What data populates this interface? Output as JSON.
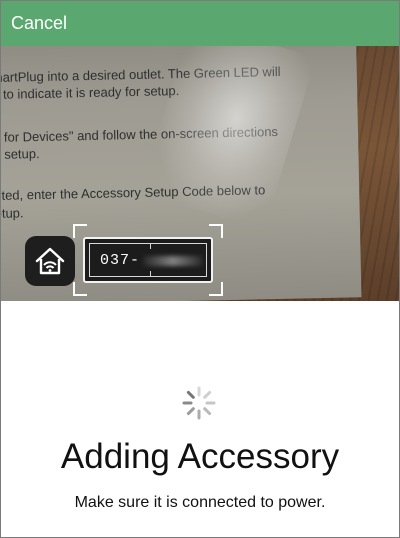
{
  "nav": {
    "cancel_label": "Cancel"
  },
  "camera": {
    "paper_lines": [
      "martPlug into a desired outlet. The Green LED will",
      "g to indicate it is ready for setup.",
      "n for Devices\" and follow the on-screen directions",
      "e setup.",
      "pted, enter the Accessory Setup Code below to",
      "etup."
    ],
    "setup_code_visible": "037-"
  },
  "status": {
    "title": "Adding Accessory",
    "subtitle": "Make sure it is connected to power."
  },
  "colors": {
    "nav_bar": "#5aa870",
    "text": "#111111",
    "background": "#ffffff"
  },
  "icons": {
    "accessory": "homekit-house-icon",
    "progress": "activity-spinner-icon"
  }
}
